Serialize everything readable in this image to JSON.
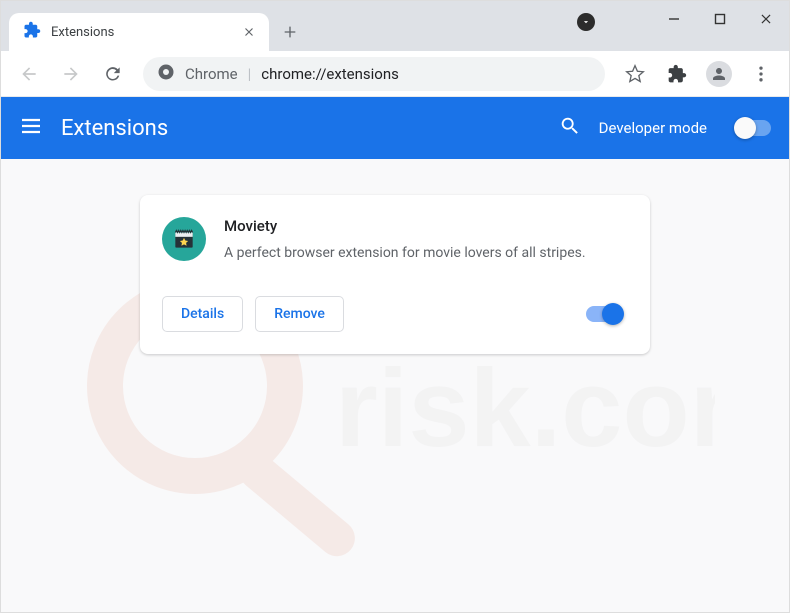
{
  "window": {
    "tab_title": "Extensions"
  },
  "toolbar": {
    "chrome_label": "Chrome",
    "url": "chrome://extensions"
  },
  "header": {
    "title": "Extensions",
    "dev_mode_label": "Developer mode"
  },
  "card": {
    "name": "Moviety",
    "description": "A perfect browser extension for movie lovers of all stripes.",
    "details_label": "Details",
    "remove_label": "Remove"
  }
}
